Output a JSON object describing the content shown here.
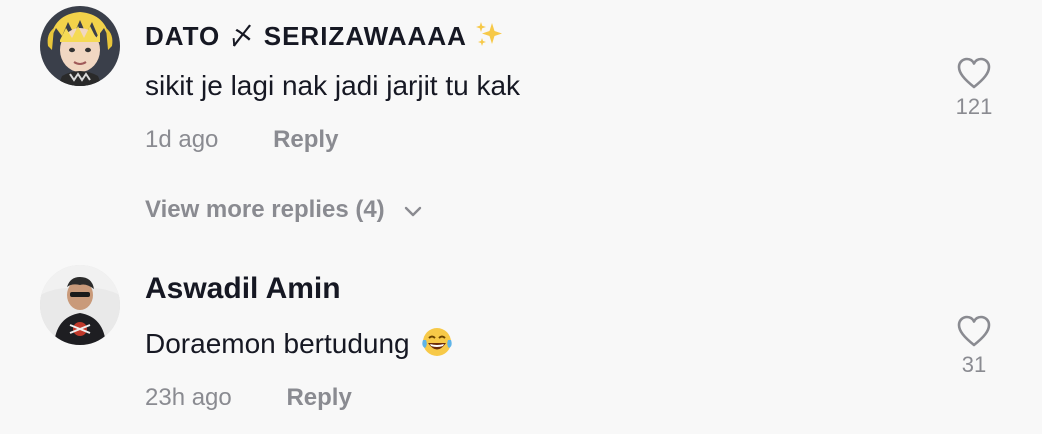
{
  "comments": [
    {
      "username": "DATO",
      "username_mark": "〆",
      "username_suffix": "SERIZAWAAAA",
      "username_emoji": "sparkles-emoji",
      "text": "sikit je lagi nak jadi jarjit tu kak",
      "time": "1d ago",
      "reply_label": "Reply",
      "likes": "121"
    },
    {
      "username": "Aswadil Amin",
      "text": "Doraemon bertudung",
      "text_emoji": "tears-of-joy-emoji",
      "time": "23h ago",
      "reply_label": "Reply",
      "likes": "31"
    }
  ],
  "view_more": "View more replies (4)",
  "colors": {
    "primary_text": "#161823",
    "secondary_text": "#8a8b91",
    "background": "#f8f8f8"
  }
}
